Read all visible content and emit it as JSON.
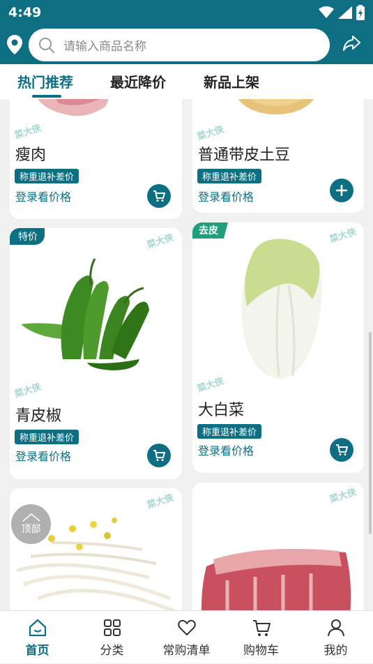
{
  "status_bar": {
    "time": "4:49"
  },
  "search": {
    "placeholder": "请输入商品名称"
  },
  "tabs": [
    {
      "label": "热门推荐",
      "active": true
    },
    {
      "label": "最近降价",
      "active": false
    },
    {
      "label": "新品上架",
      "active": false
    }
  ],
  "watermark": "菜大侠",
  "products": [
    {
      "name": "瘦肉",
      "badge": "称重退补差价",
      "price_text": "登录看价格",
      "action": "cart-icon"
    },
    {
      "name": "普通带皮土豆",
      "badge": "称重退补差价",
      "price_text": "登录看价格",
      "action": "plus-icon"
    },
    {
      "name": "青皮椒",
      "tag": "特价",
      "badge": "称重退补差价",
      "price_text": "登录看价格",
      "action": "cart-icon"
    },
    {
      "name": "大白菜",
      "tag": "去皮",
      "badge": "称重退补差价",
      "price_text": "登录看价格",
      "action": "cart-icon"
    },
    {
      "name": "",
      "action": ""
    },
    {
      "name": "",
      "action": ""
    }
  ],
  "back_to_top": {
    "label": "顶部"
  },
  "bottom_nav": [
    {
      "label": "首页",
      "icon": "home-icon",
      "active": true
    },
    {
      "label": "分类",
      "icon": "grid-icon",
      "active": false
    },
    {
      "label": "常购清单",
      "icon": "heart-icon",
      "active": false
    },
    {
      "label": "购物车",
      "icon": "cart-icon",
      "active": false
    },
    {
      "label": "我的",
      "icon": "user-icon",
      "active": false
    }
  ],
  "colors": {
    "primary": "#0e6f83",
    "peel_tag": "#1fa07a",
    "background": "#f1f1f1"
  }
}
